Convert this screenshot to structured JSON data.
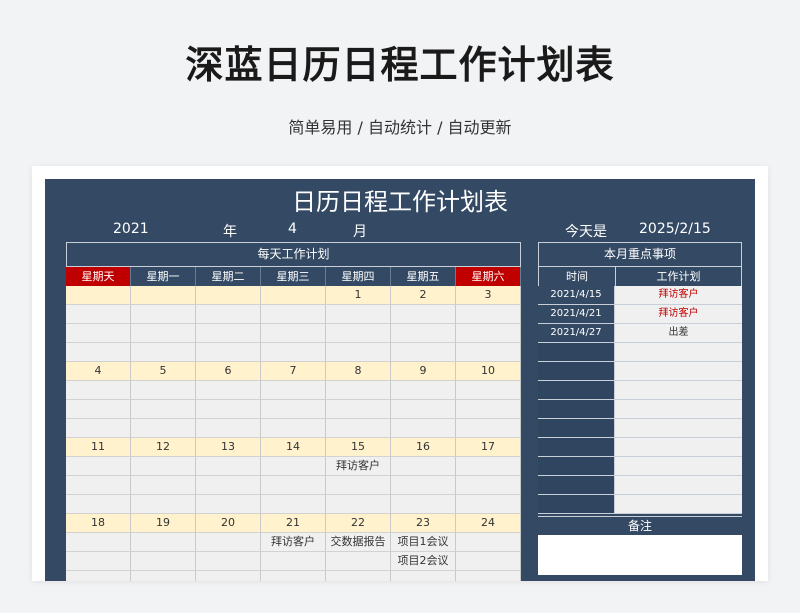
{
  "header": {
    "title": "深蓝日历日程工作计划表",
    "subtitle": "简单易用 / 自动统计 / 自动更新"
  },
  "sheet": {
    "title": "日历日程工作计划表",
    "year": "2021",
    "year_label": "年",
    "month": "4",
    "month_label": "月",
    "today_label": "今天是",
    "today": "2025/2/15"
  },
  "calendar": {
    "header": "每天工作计划",
    "weekdays": [
      "星期天",
      "星期一",
      "星期二",
      "星期三",
      "星期四",
      "星期五",
      "星期六"
    ],
    "weeks": [
      {
        "dates": [
          "",
          "",
          "",
          "",
          "1",
          "2",
          "3"
        ],
        "tasks": [
          [
            "",
            "",
            "",
            "",
            "",
            "",
            ""
          ],
          [
            "",
            "",
            "",
            "",
            "",
            "",
            ""
          ],
          [
            "",
            "",
            "",
            "",
            "",
            "",
            ""
          ]
        ]
      },
      {
        "dates": [
          "4",
          "5",
          "6",
          "7",
          "8",
          "9",
          "10"
        ],
        "tasks": [
          [
            "",
            "",
            "",
            "",
            "",
            "",
            ""
          ],
          [
            "",
            "",
            "",
            "",
            "",
            "",
            ""
          ],
          [
            "",
            "",
            "",
            "",
            "",
            "",
            ""
          ]
        ]
      },
      {
        "dates": [
          "11",
          "12",
          "13",
          "14",
          "15",
          "16",
          "17"
        ],
        "tasks": [
          [
            "",
            "",
            "",
            "",
            "拜访客户",
            "",
            ""
          ],
          [
            "",
            "",
            "",
            "",
            "",
            "",
            ""
          ],
          [
            "",
            "",
            "",
            "",
            "",
            "",
            ""
          ]
        ]
      },
      {
        "dates": [
          "18",
          "19",
          "20",
          "21",
          "22",
          "23",
          "24"
        ],
        "tasks": [
          [
            "",
            "",
            "",
            "拜访客户",
            "交数据报告",
            "项目1会议",
            ""
          ],
          [
            "",
            "",
            "",
            "",
            "",
            "项目2会议",
            ""
          ],
          [
            "",
            "",
            "",
            "",
            "",
            "",
            ""
          ]
        ]
      }
    ]
  },
  "focus": {
    "header": "本月重点事项",
    "col_time": "时间",
    "col_plan": "工作计划",
    "items": [
      {
        "date": "2021/4/15",
        "plan": "拜访客户",
        "highlight": true
      },
      {
        "date": "2021/4/21",
        "plan": "拜访客户",
        "highlight": true
      },
      {
        "date": "2021/4/27",
        "plan": "出差",
        "highlight": false
      }
    ],
    "empty_rows": 9,
    "notes_label": "备注"
  },
  "colors": {
    "sheet_bg": "#344a64",
    "weekend_header": "#c00000",
    "date_row_bg": "#fff2cc",
    "highlight_text": "#c00000"
  }
}
